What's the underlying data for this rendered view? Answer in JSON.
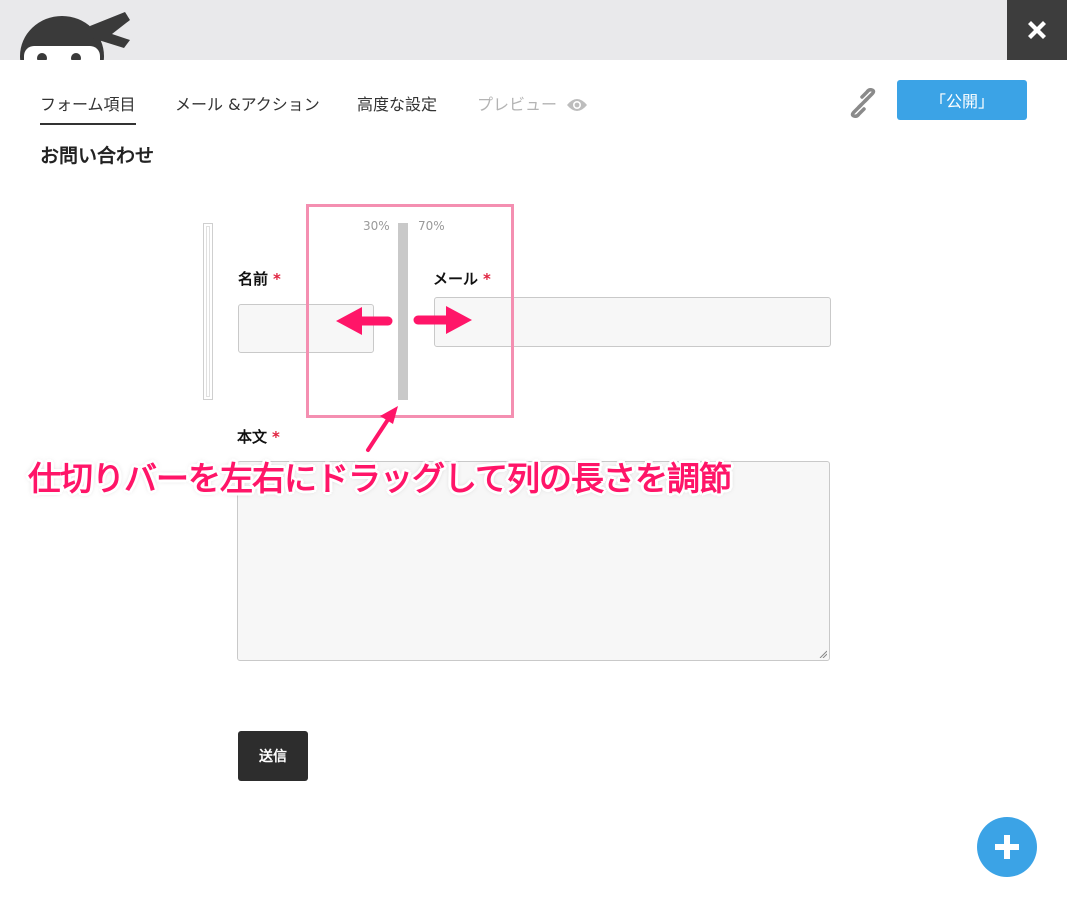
{
  "header": {
    "tabs": [
      {
        "label": "フォーム項目",
        "active": true
      },
      {
        "label": "メール &アクション",
        "active": false
      },
      {
        "label": "高度な設定",
        "active": false
      },
      {
        "label": "プレビュー",
        "active": false,
        "muted": true
      }
    ],
    "publish_label": "「公開」",
    "icons": {
      "logo": "ninja-logo-icon",
      "close": "close-icon",
      "eye": "eye-icon",
      "link": "link-icon",
      "add": "plus-icon"
    }
  },
  "form": {
    "title": "お問い合わせ",
    "divider": {
      "left_percent": "30%",
      "right_percent": "70%"
    },
    "fields": {
      "name_label": "名前",
      "email_label": "メール",
      "body_label": "本文",
      "required_mark": "*"
    },
    "submit_label": "送信"
  },
  "annotation": {
    "text": "仕切りバーを左右にドラッグして列の長さを調節",
    "color": "#ff1568"
  },
  "colors": {
    "accent": "#3ba3e6",
    "required": "#e0223f",
    "highlight": "#f48fb1"
  }
}
